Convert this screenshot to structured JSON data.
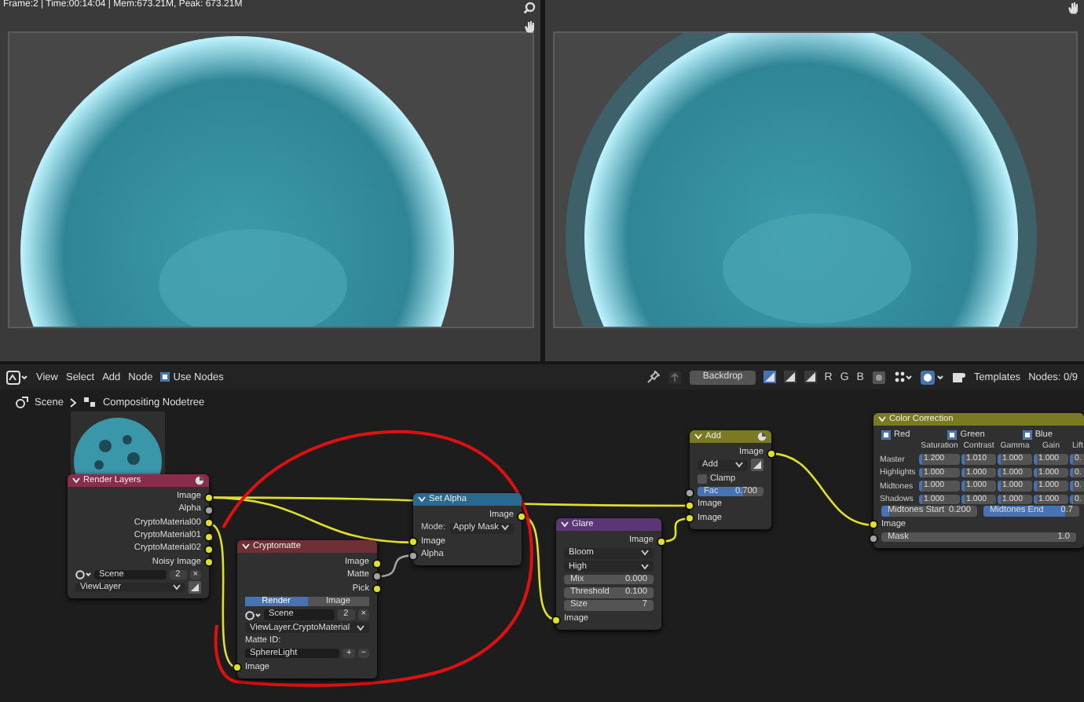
{
  "status_text": "Frame:2 | Time:00:14:04 | Mem:673.21M, Peak: 673.21M",
  "header": {
    "menus": [
      "View",
      "Select",
      "Add",
      "Node"
    ],
    "use_nodes": {
      "label": "Use Nodes",
      "checked": true
    },
    "backdrop": "Backdrop",
    "channels": [
      "R",
      "G",
      "B"
    ],
    "templates": "Templates",
    "nodes_count": "Nodes: 0/9"
  },
  "breadcrumb": [
    "Scene",
    "Compositing Nodetree"
  ],
  "nodes": [
    {
      "title": "Render Layers",
      "color": "#8a2d4c",
      "rows": [
        {
          "kind": "output",
          "label": "Image",
          "color": "#e0e02a"
        },
        {
          "kind": "output",
          "label": "Alpha",
          "color": "#a3a3a3"
        },
        {
          "kind": "output",
          "label": "CryptoMaterial00",
          "color": "#e0e02a"
        },
        {
          "kind": "output",
          "label": "CryptoMaterial01",
          "color": "#e0e02a"
        },
        {
          "kind": "output",
          "label": "CryptoMaterial02",
          "color": "#e0e02a"
        },
        {
          "kind": "output",
          "label": "Noisy Image",
          "color": "#e0e02a"
        },
        {
          "kind": "scene",
          "value": "Scene",
          "users": "2",
          "clear": "×"
        },
        {
          "kind": "dropdown",
          "value": "ViewLayer"
        }
      ]
    },
    {
      "title": "Cryptomatte",
      "color": "#6e3035",
      "rows": [
        {
          "kind": "output",
          "label": "Image",
          "color": "#e0e02a"
        },
        {
          "kind": "output",
          "label": "Matte",
          "color": "#a3a3a3"
        },
        {
          "kind": "output",
          "label": "Pick",
          "color": "#e0e02a"
        },
        {
          "kind": "tabs",
          "options": [
            {
              "label": "Render",
              "selected": true
            },
            {
              "label": "Image",
              "selected": false
            }
          ]
        },
        {
          "kind": "scene",
          "value": "Scene",
          "users": "2",
          "clear": "×"
        },
        {
          "kind": "dropdown",
          "value": "ViewLayer.CryptoMaterial"
        },
        {
          "kind": "label",
          "text": "Matte ID:"
        },
        {
          "kind": "field",
          "value": "SphereLight",
          "buttons": [
            "+",
            "−"
          ]
        },
        {
          "kind": "input",
          "label": "Image",
          "color": "#e0e02a"
        }
      ]
    },
    {
      "title": "Set Alpha",
      "color": "#2b6a90",
      "rows": [
        {
          "kind": "output",
          "label": "Image",
          "color": "#e0e02a"
        },
        {
          "kind": "dropdown",
          "label": "Mode:",
          "value": "Apply Mask"
        },
        {
          "kind": "input",
          "label": "Image",
          "color": "#e0e02a"
        },
        {
          "kind": "input",
          "label": "Alpha",
          "color": "#a3a3a3"
        }
      ]
    },
    {
      "title": "Glare",
      "color": "#5b3575",
      "rows": [
        {
          "kind": "output",
          "label": "Image",
          "color": "#e0e02a"
        },
        {
          "kind": "dropdown",
          "value": "Bloom"
        },
        {
          "kind": "dropdown",
          "value": "High"
        },
        {
          "kind": "number",
          "label": "Mix",
          "value": "0.000"
        },
        {
          "kind": "number",
          "label": "Threshold",
          "value": "0.100"
        },
        {
          "kind": "number",
          "label": "Size",
          "value": "7"
        },
        {
          "kind": "input",
          "label": "Image",
          "color": "#e0e02a"
        }
      ]
    },
    {
      "title": "Add",
      "color": "#7a7a22",
      "rows": [
        {
          "kind": "output",
          "label": "Image",
          "color": "#e0e02a"
        },
        {
          "kind": "dropdown",
          "value": "Add"
        },
        {
          "kind": "checkbox",
          "label": "Clamp",
          "checked": false
        },
        {
          "kind": "slider",
          "label": "Fac",
          "value": "0.700",
          "level": 0.7,
          "color": "#a3a3a3"
        },
        {
          "kind": "input",
          "label": "Image",
          "color": "#e0e02a"
        },
        {
          "kind": "input",
          "label": "Image",
          "color": "#e0e02a"
        }
      ]
    },
    {
      "title": "Color Correction",
      "color": "#7a7a22",
      "rows": [
        {
          "kind": "checks",
          "items": [
            {
              "label": "Red",
              "checked": true
            },
            {
              "label": "Green",
              "checked": true
            },
            {
              "label": "Blue",
              "checked": true
            }
          ]
        },
        {
          "kind": "grid",
          "columns": [
            "Saturation",
            "Contrast",
            "Gamma",
            "Gain",
            "Lift"
          ],
          "rows": [
            {
              "label": "Master",
              "values": [
                "1.200",
                "1.010",
                "1.000",
                "1.000",
                "0."
              ]
            },
            {
              "label": "Highlights",
              "values": [
                "1.000",
                "1.000",
                "1.000",
                "1.000",
                "0."
              ]
            },
            {
              "label": "Midtones",
              "values": [
                "1.000",
                "1.000",
                "1.000",
                "1.000",
                "0."
              ]
            },
            {
              "label": "Shadows",
              "values": [
                "1.000",
                "1.000",
                "1.000",
                "1.000",
                "0."
              ]
            }
          ]
        },
        {
          "kind": "slider_pair",
          "items": [
            {
              "label": "Midtones Start",
              "value": "0.200",
              "level": 0.08
            },
            {
              "label": "Midtones End",
              "value": "0.7",
              "level": 0.85
            }
          ]
        },
        {
          "kind": "input",
          "label": "Image",
          "color": "#e0e02a"
        },
        {
          "kind": "number",
          "label": "Mask",
          "value": "1.0",
          "color": "#a3a3a3"
        }
      ]
    }
  ]
}
